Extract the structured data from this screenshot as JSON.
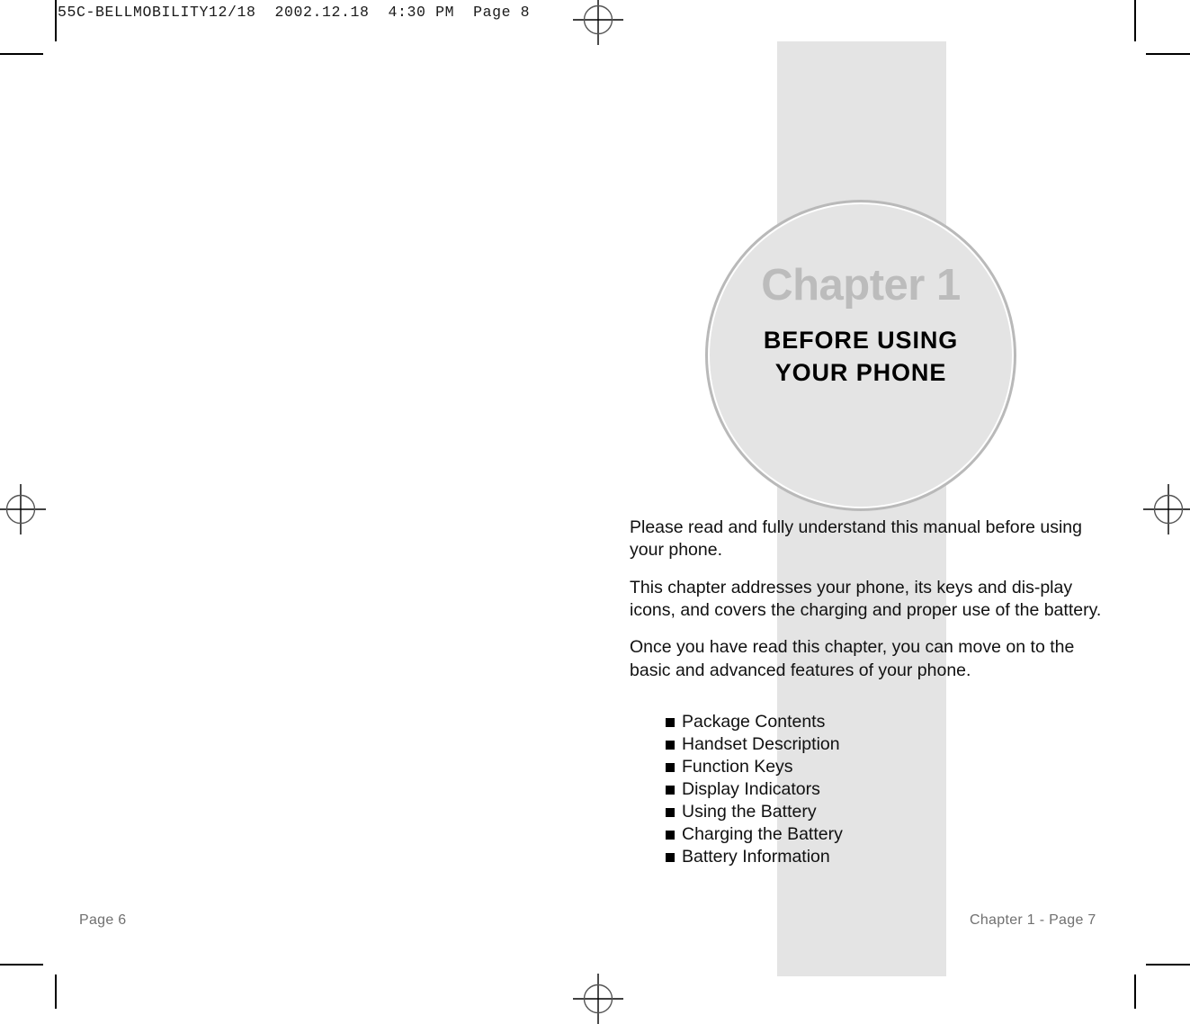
{
  "print_header": {
    "text": "55C-BELLMOBILITY12/18  2002.12.18  4:30 PM  Page 8"
  },
  "chapter": {
    "kicker": "Chapter 1",
    "title_line1": "BEFORE USING",
    "title_line2": "YOUR PHONE",
    "kicker_color": "#bcbcbc",
    "circle_fill": "#e4e4e4",
    "ring_color": "#b9b9b9"
  },
  "body": {
    "paragraphs": [
      "Please read and fully understand this manual before using your phone.",
      "This chapter addresses your phone, its keys and dis-play icons, and covers the charging and proper use of the battery.",
      "Once you have read this chapter, you can move on to the basic and advanced features of your phone."
    ]
  },
  "contents": {
    "items": [
      "Package Contents",
      "Handset Description",
      "Function Keys",
      "Display Indicators",
      "Using the Battery",
      "Charging the Battery",
      "Battery Information"
    ]
  },
  "footer": {
    "left": "Page 6",
    "right": "Chapter 1 - Page 7"
  }
}
